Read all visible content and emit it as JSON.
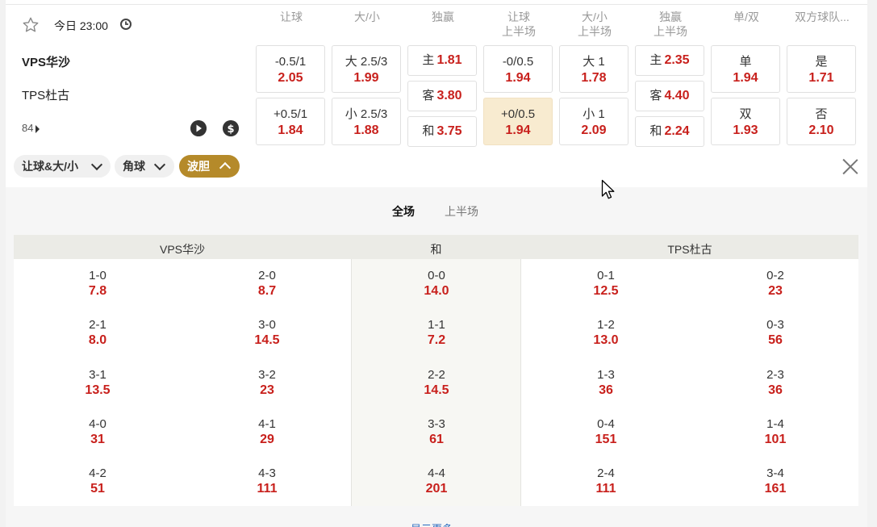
{
  "match": {
    "time": "今日 23:00",
    "home": "VPS华沙",
    "away": "TPS杜古",
    "more_count": "84"
  },
  "headers": [
    "让球",
    "大/小",
    "独赢",
    "让球\n上半场",
    "大/小\n上半场",
    "独赢\n上半场",
    "单/双",
    "双方球队..."
  ],
  "odds": {
    "handicap": [
      {
        "label": "-0.5/1",
        "odd": "2.05"
      },
      {
        "label": "+0.5/1",
        "odd": "1.84"
      }
    ],
    "over_under": [
      {
        "label": "大 2.5/3",
        "odd": "1.99"
      },
      {
        "label": "小 2.5/3",
        "odd": "1.88"
      }
    ],
    "moneyline": [
      {
        "label": "主",
        "odd": "1.81"
      },
      {
        "label": "客",
        "odd": "3.80"
      },
      {
        "label": "和",
        "odd": "3.75"
      }
    ],
    "handicap_1h": [
      {
        "label": "-0/0.5",
        "odd": "1.94"
      },
      {
        "label": "+0/0.5",
        "odd": "1.94"
      }
    ],
    "over_under_1h": [
      {
        "label": "大 1",
        "odd": "1.78"
      },
      {
        "label": "小 1",
        "odd": "2.09"
      }
    ],
    "moneyline_1h": [
      {
        "label": "主",
        "odd": "2.35"
      },
      {
        "label": "客",
        "odd": "4.40"
      },
      {
        "label": "和",
        "odd": "2.24"
      }
    ],
    "odd_even": [
      {
        "label": "单",
        "odd": "1.94"
      },
      {
        "label": "双",
        "odd": "1.93"
      }
    ],
    "btts": [
      {
        "label": "是",
        "odd": "1.71"
      },
      {
        "label": "否",
        "odd": "2.10"
      }
    ]
  },
  "filters": [
    "让球&大/小",
    "角球",
    "波胆"
  ],
  "panel_tabs": [
    "全场",
    "上半场"
  ],
  "grid_headers": [
    "VPS华沙",
    "和",
    "TPS杜古"
  ],
  "correct_scores": {
    "home_a": [
      {
        "s": "1-0",
        "o": "7.8"
      },
      {
        "s": "2-1",
        "o": "8.0"
      },
      {
        "s": "3-1",
        "o": "13.5"
      },
      {
        "s": "4-0",
        "o": "31"
      },
      {
        "s": "4-2",
        "o": "51"
      }
    ],
    "home_b": [
      {
        "s": "2-0",
        "o": "8.7"
      },
      {
        "s": "3-0",
        "o": "14.5"
      },
      {
        "s": "3-2",
        "o": "23"
      },
      {
        "s": "4-1",
        "o": "29"
      },
      {
        "s": "4-3",
        "o": "111"
      }
    ],
    "draw": [
      {
        "s": "0-0",
        "o": "14.0"
      },
      {
        "s": "1-1",
        "o": "7.2"
      },
      {
        "s": "2-2",
        "o": "14.5"
      },
      {
        "s": "3-3",
        "o": "61"
      },
      {
        "s": "4-4",
        "o": "201"
      }
    ],
    "away_a": [
      {
        "s": "0-1",
        "o": "12.5"
      },
      {
        "s": "1-2",
        "o": "13.0"
      },
      {
        "s": "1-3",
        "o": "36"
      },
      {
        "s": "0-4",
        "o": "151"
      },
      {
        "s": "2-4",
        "o": "111"
      }
    ],
    "away_b": [
      {
        "s": "0-2",
        "o": "23"
      },
      {
        "s": "0-3",
        "o": "56"
      },
      {
        "s": "2-3",
        "o": "36"
      },
      {
        "s": "1-4",
        "o": "101"
      },
      {
        "s": "3-4",
        "o": "161"
      }
    ]
  },
  "bottom_link": "显示更多",
  "icons": [
    "star-icon",
    "clock-icon",
    "play-icon",
    "dollar-icon",
    "chevron-down-icon",
    "chevron-up-icon",
    "close-icon"
  ],
  "colors": {
    "odd": "#c8201c",
    "accent": "#b58a2a",
    "highlight": "#f8ebd0"
  }
}
